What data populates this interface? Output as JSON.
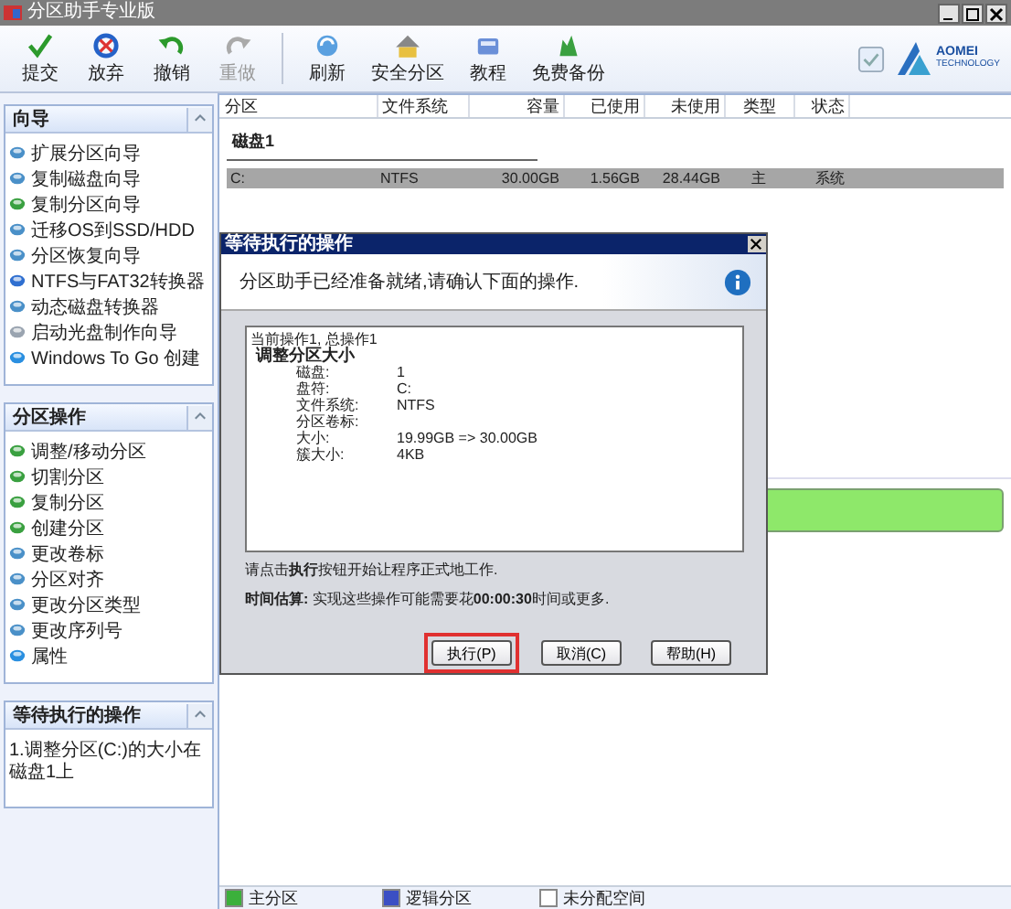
{
  "window": {
    "title": "分区助手专业版"
  },
  "toolbar": [
    {
      "label": "提交",
      "kind": "check",
      "disabled": false
    },
    {
      "label": "放弃",
      "kind": "discard",
      "disabled": false
    },
    {
      "label": "撤销",
      "kind": "undo",
      "disabled": false
    },
    {
      "label": "重做",
      "kind": "redo",
      "disabled": true
    },
    {
      "label": "刷新",
      "kind": "refresh",
      "disabled": false
    },
    {
      "label": "安全分区",
      "kind": "safe",
      "disabled": false
    },
    {
      "label": "教程",
      "kind": "book",
      "disabled": false
    },
    {
      "label": "免费备份",
      "kind": "backup",
      "disabled": false
    }
  ],
  "logo": {
    "name": "AOMEI",
    "tagline": "TECHNOLOGY"
  },
  "sidebar": {
    "panels": [
      {
        "title": "向导",
        "items": [
          {
            "label": "扩展分区向导",
            "kind": "disk"
          },
          {
            "label": "复制磁盘向导",
            "kind": "disk"
          },
          {
            "label": "复制分区向导",
            "kind": "copy"
          },
          {
            "label": "迁移OS到SSD/HDD",
            "kind": "disk"
          },
          {
            "label": "分区恢复向导",
            "kind": "disk"
          },
          {
            "label": "NTFS与FAT32转换器",
            "kind": "convert"
          },
          {
            "label": "动态磁盘转换器",
            "kind": "disk"
          },
          {
            "label": "启动光盘制作向导",
            "kind": "cd"
          },
          {
            "label": "Windows To Go 创建",
            "kind": "globe"
          }
        ]
      },
      {
        "title": "分区操作",
        "items": [
          {
            "label": "调整/移动分区",
            "kind": "copy"
          },
          {
            "label": "切割分区",
            "kind": "copy"
          },
          {
            "label": "复制分区",
            "kind": "copy"
          },
          {
            "label": "创建分区",
            "kind": "copy"
          },
          {
            "label": "更改卷标",
            "kind": "disk"
          },
          {
            "label": "分区对齐",
            "kind": "disk"
          },
          {
            "label": "更改分区类型",
            "kind": "disk"
          },
          {
            "label": "更改序列号",
            "kind": "disk"
          },
          {
            "label": "属性",
            "kind": "globe"
          }
        ]
      },
      {
        "title": "等待执行的操作",
        "items": [
          {
            "label": "1.调整分区(C:)的大小在磁盘1上",
            "kind": "text"
          }
        ]
      }
    ]
  },
  "table": {
    "columns": [
      "分区",
      "文件系统",
      "容量",
      "已使用",
      "未使用",
      "类型",
      "状态"
    ],
    "disks": [
      {
        "name": "磁盘1",
        "rows": [
          {
            "cells": [
              "C:",
              "NTFS",
              "30.00GB",
              "1.56GB",
              "28.44GB",
              "主",
              "系统"
            ],
            "selected": true
          }
        ]
      }
    ]
  },
  "dialog": {
    "title": "等待执行的操作",
    "message": "分区助手已经准备就绪,请确认下面的操作.",
    "summary": "当前操作1, 总操作1",
    "operation": "调整分区大小",
    "details": [
      {
        "label": "磁盘:",
        "value": "1"
      },
      {
        "label": "盘符:",
        "value": "C:"
      },
      {
        "label": "文件系统:",
        "value": "NTFS"
      },
      {
        "label": "分区卷标:"
      },
      {
        "label": "大小:",
        "value": "19.99GB => 30.00GB"
      },
      {
        "label": "簇大小:",
        "value": "4KB"
      }
    ],
    "hint": "请点击**执行**按钮开始让程序正式地工作.",
    "estimate": "**时间估算:** 实现这些操作可能需要花**00:00:30**时间或更多.",
    "buttons": [
      {
        "label": "执行(P)",
        "highlighted": true
      },
      {
        "label": "取消(C)",
        "highlighted": false
      },
      {
        "label": "帮助(H)",
        "highlighted": false
      }
    ]
  },
  "legend": [
    {
      "label": "主分区",
      "color": "#3cb03c"
    },
    {
      "label": "逻辑分区",
      "color": "#3b4fc4"
    },
    {
      "label": "未分配空间",
      "color": "#ffffff"
    }
  ]
}
